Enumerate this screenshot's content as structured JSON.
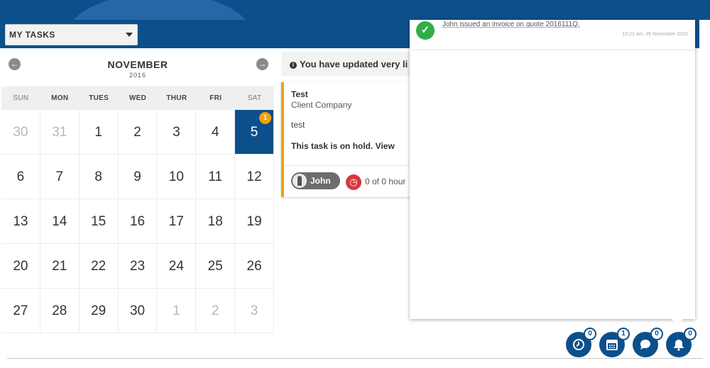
{
  "header": {
    "task_filter": "MY TASKS"
  },
  "calendar": {
    "month": "NOVEMBER",
    "year": "2016",
    "weekdays": [
      "SUN",
      "MON",
      "TUES",
      "WED",
      "THUR",
      "FRI",
      "SAT"
    ],
    "weeks": [
      [
        "30",
        "31",
        "1",
        "2",
        "3",
        "4",
        "5"
      ],
      [
        "6",
        "7",
        "8",
        "9",
        "10",
        "11",
        "12"
      ],
      [
        "13",
        "14",
        "15",
        "16",
        "17",
        "18",
        "19"
      ],
      [
        "20",
        "21",
        "22",
        "23",
        "24",
        "25",
        "26"
      ],
      [
        "27",
        "28",
        "29",
        "30",
        "1",
        "2",
        "3"
      ]
    ],
    "today_badge": "1"
  },
  "alert": {
    "text": "You have updated very li"
  },
  "task_card": {
    "title": "Test",
    "company": "Client Company",
    "description": "test",
    "status": "This task is on hold. View",
    "user": "John",
    "hours": "0 of 0 hour"
  },
  "notifications": {
    "items": [
      {
        "text": "John issued an invoice on quote 2016111Q.",
        "time": "10:21 am, 05 November 2016"
      }
    ]
  },
  "fabs": {
    "timer_count": "0",
    "calendar_count": "1",
    "chat_count": "0",
    "bell_count": "0"
  },
  "colors": {
    "primary": "#0d4f8b",
    "badge": "#f0a30a",
    "success": "#2fae4a",
    "danger": "#d9363e"
  }
}
